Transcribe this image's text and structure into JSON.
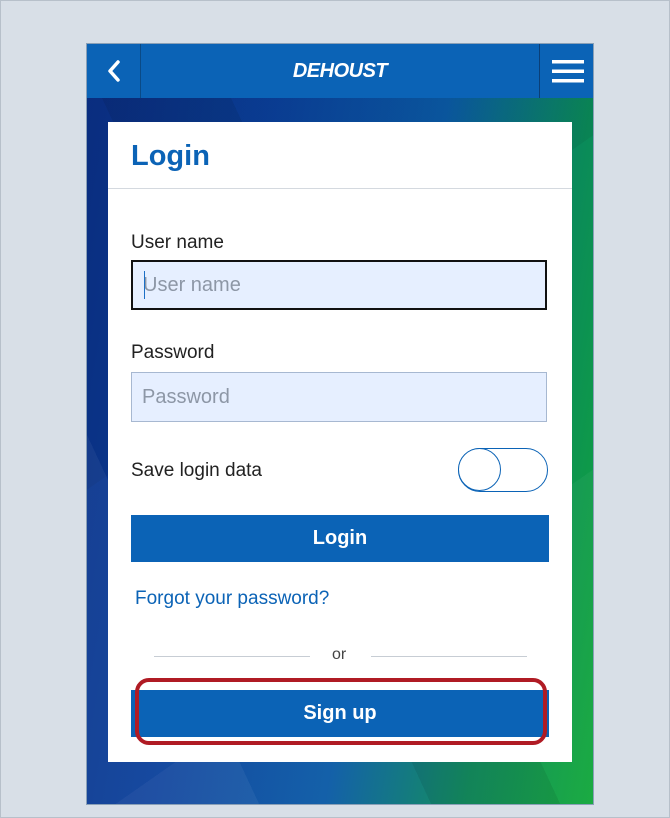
{
  "app": {
    "title": "DEHOUST"
  },
  "colors": {
    "primary": "#0b63b6",
    "highlight": "#b01b24"
  },
  "icons": {
    "back": "chevron-left-icon",
    "menu": "hamburger-menu-icon"
  },
  "login": {
    "title": "Login",
    "username_label": "User name",
    "username_placeholder": "User name",
    "password_label": "Password",
    "password_placeholder": "Password",
    "save_label": "Save login data",
    "save_toggle_on": false,
    "login_button": "Login",
    "forgot_link": "Forgot your password?",
    "or_text": "or",
    "signup_button": "Sign up"
  }
}
